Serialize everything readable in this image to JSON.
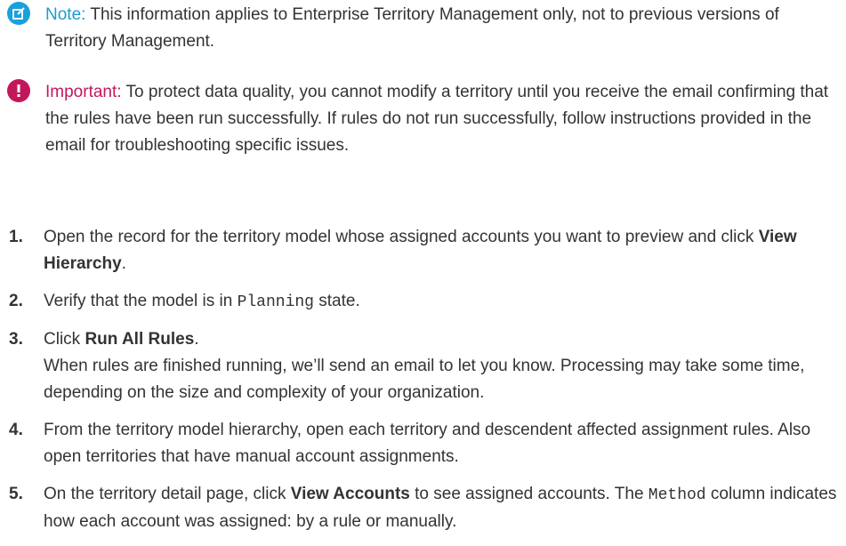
{
  "note": {
    "label": "Note:",
    "text": "This information applies to Enterprise Territory Management only, not to previous versions of Territory Management."
  },
  "important": {
    "label": "Important:",
    "text": "To protect data quality, you cannot modify a territory until you receive the email confirming that the rules have been run successfully. If rules do not run successfully, follow instructions provided in the email for troubleshooting specific issues."
  },
  "colors": {
    "note": "#1aa0dc",
    "important": "#c2185b"
  },
  "icons": {
    "note": "edit-note-icon",
    "important": "exclamation-icon"
  },
  "steps": [
    {
      "num": "1.",
      "text_before": "Open the record for the territory model whose assigned accounts you want to preview and click ",
      "bold": "View Hierarchy",
      "text_after": "."
    },
    {
      "num": "2.",
      "text_before": "Verify that the model is in ",
      "code": "Planning",
      "text_after": " state."
    },
    {
      "num": "3.",
      "text_before": "Click ",
      "bold": "Run All Rules",
      "text_after": ".",
      "detail": "When rules are finished running, we’ll send an email to let you know. Processing may take some time, depending on the size and complexity of your organization."
    },
    {
      "num": "4.",
      "text": "From the territory model hierarchy, open each territory and descendent affected assignment rules. Also open territories that have manual account assignments."
    },
    {
      "num": "5.",
      "text_before": "On the territory detail page, click ",
      "bold": "View Accounts",
      "text_mid": " to see assigned accounts. The ",
      "code": "Method",
      "text_after": " column indicates how each account was assigned: by a rule or manually."
    }
  ]
}
